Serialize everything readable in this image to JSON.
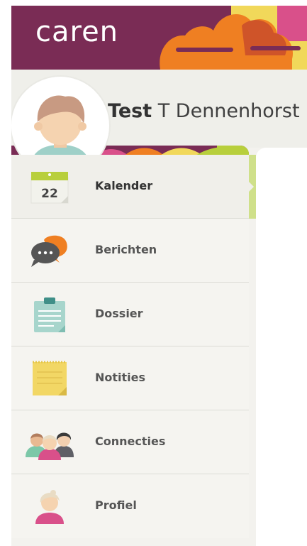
{
  "app": {
    "logo_text": "caren"
  },
  "user": {
    "first_name": "Test",
    "rest_name": "T Dennenhorst"
  },
  "menu": {
    "items": [
      {
        "label": "Kalender",
        "icon": "calendar-icon",
        "active": true
      },
      {
        "label": "Berichten",
        "icon": "messages-icon",
        "active": false
      },
      {
        "label": "Dossier",
        "icon": "clipboard-icon",
        "active": false
      },
      {
        "label": "Notities",
        "icon": "notepad-icon",
        "active": false
      },
      {
        "label": "Connecties",
        "icon": "people-icon",
        "active": false
      },
      {
        "label": "Profiel",
        "icon": "profile-icon",
        "active": false
      }
    ]
  },
  "calendar_icon": {
    "day": "22"
  },
  "colors": {
    "header": "#7a2c55",
    "accent_green": "#b8cf3c",
    "accent_orange": "#ef7f22",
    "accent_yellow": "#f1d85a",
    "accent_pink": "#d9508a"
  }
}
